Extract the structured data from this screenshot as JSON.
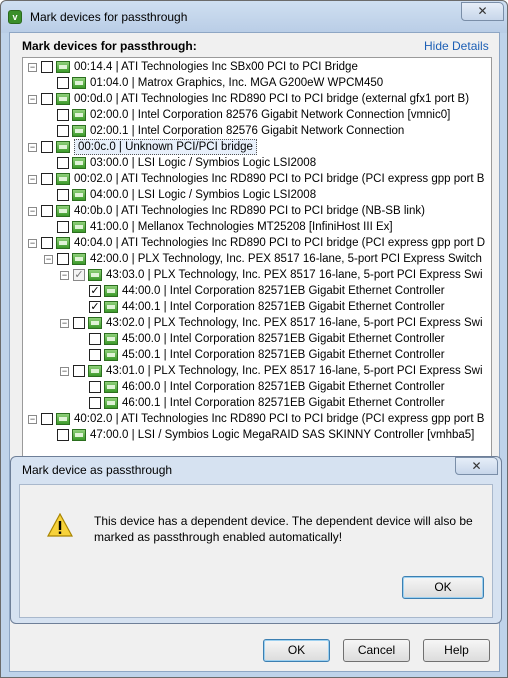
{
  "window": {
    "title": "Mark devices for passthrough",
    "close_glyph": "✕",
    "app_icon": "vsphere-icon"
  },
  "main": {
    "section_title": "Mark devices for passthrough:",
    "hide_details": "Hide Details"
  },
  "tree": [
    {
      "label": "00:14.4 | ATI Technologies Inc SBx00 PCI to PCI Bridge",
      "check": "empty",
      "expander": "−"
    },
    {
      "label": "01:04.0 | Matrox Graphics, Inc. MGA G200eW WPCM450",
      "check": "empty"
    },
    {
      "label": "00:0d.0 | ATI Technologies Inc RD890 PCI to PCI bridge (external gfx1 port B)",
      "check": "empty",
      "expander": "−"
    },
    {
      "label": "02:00.0 | Intel Corporation 82576 Gigabit Network Connection [vmnic0]",
      "check": "empty"
    },
    {
      "label": "02:00.1 | Intel Corporation 82576 Gigabit Network Connection",
      "check": "empty"
    },
    {
      "label": "00:0c.0 | Unknown PCI/PCI bridge",
      "check": "empty",
      "expander": "−",
      "selected": true
    },
    {
      "label": "03:00.0 | LSI Logic / Symbios Logic LSI2008",
      "check": "empty"
    },
    {
      "label": "00:02.0 | ATI Technologies Inc RD890 PCI to PCI bridge (PCI express gpp port B",
      "check": "empty",
      "expander": "−"
    },
    {
      "label": "04:00.0 | LSI Logic / Symbios Logic LSI2008",
      "check": "empty"
    },
    {
      "label": "40:0b.0 | ATI Technologies Inc RD890 PCI to PCI bridge (NB-SB link)",
      "check": "empty",
      "expander": "−"
    },
    {
      "label": "41:00.0 | Mellanox Technologies MT25208 [InfiniHost III Ex]",
      "check": "empty"
    },
    {
      "label": "40:04.0 | ATI Technologies Inc RD890 PCI to PCI bridge (PCI express gpp port D",
      "check": "empty",
      "expander": "−"
    },
    {
      "label": "42:00.0 | PLX Technology, Inc. PEX 8517 16-lane, 5-port PCI Express Switch",
      "check": "empty",
      "expander": "−"
    },
    {
      "label": "43:03.0 | PLX Technology, Inc. PEX 8517 16-lane, 5-port PCI Express Swi",
      "check": "partial",
      "expander": "−"
    },
    {
      "label": "44:00.0 | Intel Corporation 82571EB Gigabit Ethernet Controller",
      "check": "checked"
    },
    {
      "label": "44:00.1 | Intel Corporation 82571EB Gigabit Ethernet Controller",
      "check": "checked"
    },
    {
      "label": "43:02.0 | PLX Technology, Inc. PEX 8517 16-lane, 5-port PCI Express Swi",
      "check": "empty",
      "expander": "−"
    },
    {
      "label": "45:00.0 | Intel Corporation 82571EB Gigabit Ethernet Controller",
      "check": "empty"
    },
    {
      "label": "45:00.1 | Intel Corporation 82571EB Gigabit Ethernet Controller",
      "check": "empty"
    },
    {
      "label": "43:01.0 | PLX Technology, Inc. PEX 8517 16-lane, 5-port PCI Express Swi",
      "check": "empty",
      "expander": "−"
    },
    {
      "label": "46:00.0 | Intel Corporation 82571EB Gigabit Ethernet Controller",
      "check": "empty"
    },
    {
      "label": "46:00.1 | Intel Corporation 82571EB Gigabit Ethernet Controller",
      "check": "empty"
    },
    {
      "label": "40:02.0 | ATI Technologies Inc RD890 PCI to PCI bridge (PCI express gpp port B",
      "check": "empty",
      "expander": "−"
    },
    {
      "label": "47:00.0 | LSI / Symbios Logic MegaRAID SAS SKINNY Controller [vmhba5]",
      "check": "empty"
    }
  ],
  "dialog": {
    "title": "Mark device as passthrough",
    "close_glyph": "✕",
    "message": "This device has a dependent device. The dependent device will also be marked as passthrough enabled automatically!",
    "ok_label": "OK",
    "icon": "warning-icon"
  },
  "footer": {
    "ok_label": "OK",
    "cancel_label": "Cancel",
    "help_label": "Help"
  }
}
